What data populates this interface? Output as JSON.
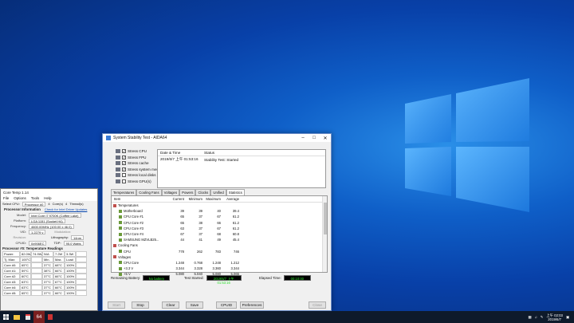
{
  "coretemp": {
    "title": "Core Temp 1.14",
    "menu": [
      "File",
      "Options",
      "Tools",
      "Help"
    ],
    "select_cpu_label": "Select CPU:",
    "select_cpu_value": "Processor #0",
    "cores_count": "4",
    "cores_label": "Core(s)",
    "threads_count": "4",
    "threads_label": "Thread(s)",
    "proc_info_header": "Processor Information",
    "driver_link": "Check for Intel Driver Updates",
    "model_label": "Model:",
    "model_value": "Intel Core i7 9700K (Coffee Lake)",
    "platform_label": "Platform:",
    "platform_value": "LGA 1151 (Socket H4)",
    "frequency_label": "Frequency:",
    "frequency_value": "4600.00MHz (100.00 x 46.0)",
    "vid_label": "VID:",
    "vid_value": "1.2279 v",
    "modulation_label": "Modulation:",
    "revision_label": "Revision:",
    "lithography_label": "Lithography:",
    "lithography_value": "14nm",
    "cpuid_label": "CPUID:",
    "cpuid_value": "0x906EC",
    "tdp_label": "TDP:",
    "tdp_value": "95.0 Watts",
    "temp_header": "Processor #0: Temperature Readings",
    "power_row": [
      "Power:",
      "82.0W",
      "74.9W",
      "N/A",
      "7.2W",
      "3.3W"
    ],
    "tjmax_row": [
      "Tj. Max:",
      "100°C",
      "",
      "Min.",
      "Max.",
      "Load"
    ],
    "cores": [
      [
        "Core #0:",
        "65°C",
        "",
        "37°C",
        "68°C",
        "100%"
      ],
      [
        "Core #1:",
        "59°C",
        "",
        "38°C",
        "66°C",
        "100%"
      ],
      [
        "Core #2:",
        "60°C",
        "",
        "37°C",
        "66°C",
        "100%"
      ],
      [
        "Core #3:",
        "63°C",
        "",
        "37°C",
        "67°C",
        "100%"
      ],
      [
        "Core #4:",
        "63°C",
        "",
        "37°C",
        "66°C",
        "100%"
      ],
      [
        "Core #5:",
        "65°C",
        "",
        "37°C",
        "66°C",
        "100%"
      ]
    ]
  },
  "aida": {
    "title": "System Stability Test - AIDA64",
    "checks": [
      {
        "label": "Stress CPU",
        "checked": true
      },
      {
        "label": "Stress FPU",
        "checked": true
      },
      {
        "label": "Stress cache",
        "checked": true
      },
      {
        "label": "Stress system memory",
        "checked": true
      },
      {
        "label": "Stress local disks",
        "checked": false
      },
      {
        "label": "Stress GPU(s)",
        "checked": false
      }
    ],
    "log_header": [
      "Date & Time",
      "Status"
    ],
    "log_row": [
      "2019/6/7 上午 01:53:16",
      "Stability Test: Started"
    ],
    "tabs": [
      "Temperatures",
      "Cooling Fans",
      "Voltages",
      "Powers",
      "Clocks",
      "Unified",
      "Statistics"
    ],
    "stats_header": [
      "Item",
      "Current",
      "Minimum",
      "Maximum",
      "Average"
    ],
    "stats": [
      {
        "kind": "grp",
        "item": "Temperatures",
        "v": [
          "",
          "",
          "",
          ""
        ]
      },
      {
        "kind": "sub",
        "item": "Motherboard",
        "v": [
          "39",
          "39",
          "40",
          "39.4"
        ]
      },
      {
        "kind": "sub",
        "item": "CPU Core #1",
        "v": [
          "65",
          "37",
          "67",
          "61.2"
        ]
      },
      {
        "kind": "sub",
        "item": "CPU Core #2",
        "v": [
          "65",
          "38",
          "66",
          "61.2"
        ]
      },
      {
        "kind": "sub",
        "item": "CPU Core #3",
        "v": [
          "63",
          "37",
          "67",
          "61.2"
        ]
      },
      {
        "kind": "sub",
        "item": "CPU Core #4",
        "v": [
          "67",
          "37",
          "68",
          "60.8"
        ]
      },
      {
        "kind": "sub",
        "item": "SAMSUNG MZVLB25...",
        "v": [
          "44",
          "41",
          "49",
          "45.4"
        ]
      },
      {
        "kind": "grp",
        "item": "Cooling Fans",
        "v": [
          "",
          "",
          "",
          ""
        ]
      },
      {
        "kind": "sub",
        "item": "CPU",
        "v": [
          "778",
          "262",
          "783",
          "746"
        ]
      },
      {
        "kind": "grp",
        "item": "Voltages",
        "v": [
          "",
          "",
          "",
          ""
        ]
      },
      {
        "kind": "sub",
        "item": "CPU Core",
        "v": [
          "1.248",
          "0.768",
          "1.248",
          "1.212"
        ]
      },
      {
        "kind": "sub",
        "item": "+3.3 V",
        "v": [
          "3.344",
          "3.328",
          "3.360",
          "3.344"
        ]
      },
      {
        "kind": "sub",
        "item": "+5 V",
        "v": [
          "5.080",
          "5.040",
          "5.080",
          "5.065"
        ]
      }
    ],
    "remaining_battery_label": "Remaining Battery:",
    "remaining_battery_value": "No battery",
    "test_started_label": "Test Started:",
    "test_started_value": "2019/6/7 上午 01:53:16",
    "elapsed_label": "Elapsed Time:",
    "elapsed_value": "00:10:00",
    "buttons": {
      "start": "Start",
      "stop": "Stop",
      "clear": "Clear",
      "save": "Save",
      "cpuid": "CPUID",
      "preferences": "Preferences",
      "close": "Close"
    }
  },
  "taskbar": {
    "app64_label": "64",
    "clock_time": "上午 02:03",
    "clock_date": "2019/6/7"
  },
  "colors": {
    "lcd_text": "#2fe22f",
    "taskbar": "#0e1a2b"
  }
}
